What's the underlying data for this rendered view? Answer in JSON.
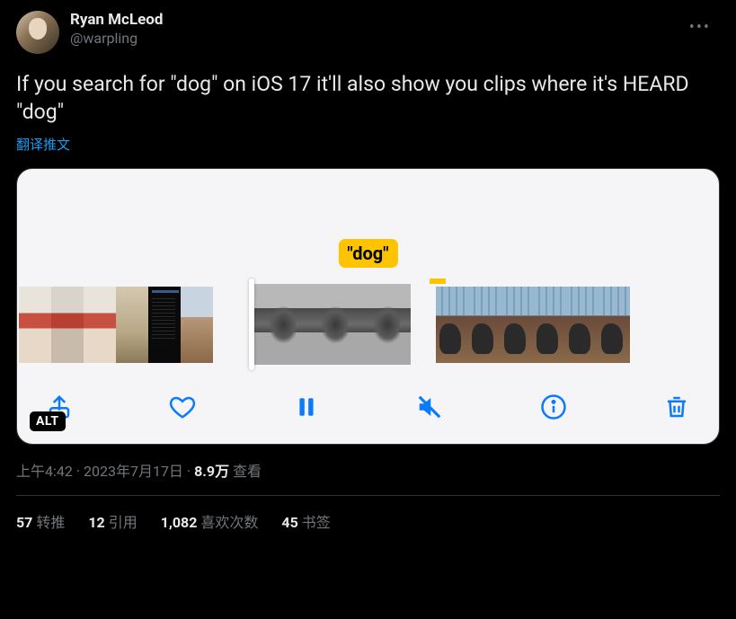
{
  "user": {
    "display_name": "Ryan McLeod",
    "handle": "@warpling"
  },
  "tweet_text": "If you search for \"dog\" on iOS 17 it'll also show you clips where it's HEARD \"dog\"",
  "translate_label": "翻译推文",
  "media": {
    "caption_text": "\"dog\"",
    "alt_badge": "ALT",
    "controls": {
      "share": "share-icon",
      "like": "heart-icon",
      "pause": "pause-icon",
      "mute": "mute-icon",
      "info": "info-icon",
      "trash": "trash-icon"
    }
  },
  "meta": {
    "time": "上午4:42",
    "date": "2023年7月17日",
    "views_count": "8.9万",
    "views_label": "查看"
  },
  "stats": {
    "retweets_count": "57",
    "retweets_label": "转推",
    "quotes_count": "12",
    "quotes_label": "引用",
    "likes_count": "1,082",
    "likes_label": "喜欢次数",
    "bookmarks_count": "45",
    "bookmarks_label": "书签"
  }
}
